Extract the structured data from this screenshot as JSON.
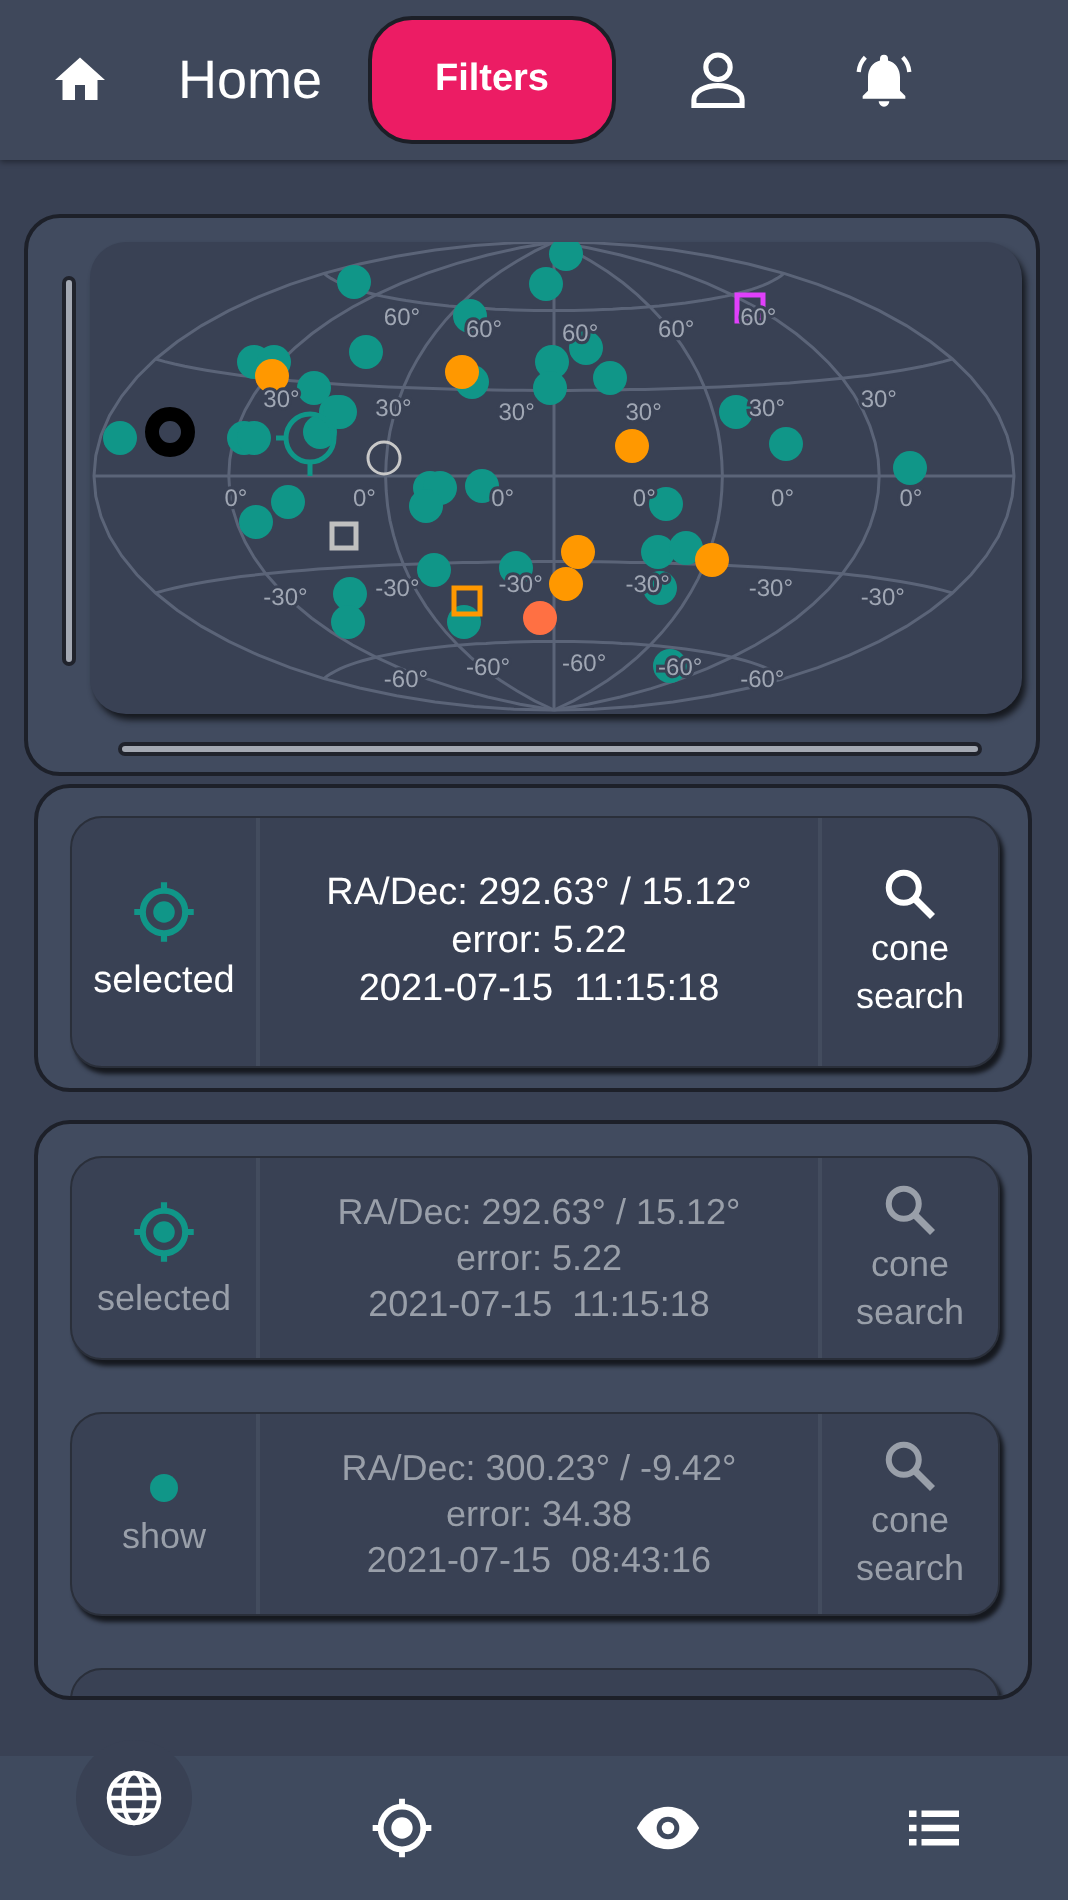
{
  "header": {
    "title": "Home",
    "filters_button": {
      "label": "Filters",
      "selected": true
    }
  },
  "sky_map": {
    "latitude_rows": [
      {
        "labels": [
          "60°",
          "60°",
          "60°",
          "60°",
          "60°"
        ]
      },
      {
        "labels": [
          "30°",
          "30°",
          "30°",
          "30°",
          "30°",
          "30°"
        ]
      },
      {
        "labels": [
          "0°",
          "0°",
          "0°",
          "0°",
          "0°",
          "0°"
        ]
      },
      {
        "labels": [
          "-30°",
          "-30°",
          "-30°",
          "-30°",
          "-30°",
          "-30°"
        ]
      },
      {
        "labels": [
          "-60°",
          "-60°",
          "-60°",
          "-60°",
          "-60°"
        ]
      }
    ]
  },
  "detail": {
    "kind": "selected",
    "status": "selected",
    "coords": "RA/Dec: 292.63° / 15.12°",
    "error": "error: 5.22",
    "time": "2021-07-15  11:15:18",
    "action": "cone search"
  },
  "alerts": [
    {
      "kind": "selected",
      "status": "selected",
      "coords": "RA/Dec: 292.63° / 15.12°",
      "error": "error: 5.22",
      "time": "2021-07-15  11:15:18",
      "action": "cone search"
    },
    {
      "kind": "show",
      "status": "show",
      "coords": "RA/Dec: 300.23° / -9.42°",
      "error": "error: 34.38",
      "time": "2021-07-15  08:43:16",
      "action": "cone search"
    }
  ],
  "nav": [
    {
      "kind": "globe",
      "selected": true
    },
    {
      "kind": "target",
      "selected": false
    },
    {
      "kind": "eye",
      "selected": false
    },
    {
      "kind": "list",
      "selected": false
    }
  ]
}
